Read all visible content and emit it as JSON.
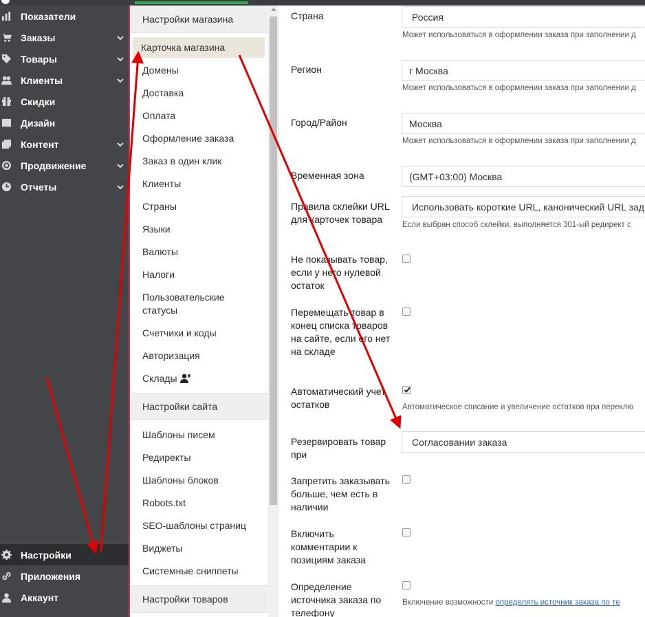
{
  "nav": {
    "items": [
      {
        "label": "Показатели",
        "icon": "bar-chart-icon",
        "chevron": false
      },
      {
        "label": "Заказы",
        "icon": "cart-icon",
        "chevron": true
      },
      {
        "label": "Товары",
        "icon": "tag-icon",
        "chevron": true
      },
      {
        "label": "Клиенты",
        "icon": "users-icon",
        "chevron": true
      },
      {
        "label": "Скидки",
        "icon": "gift-icon",
        "chevron": false
      },
      {
        "label": "Дизайн",
        "icon": "image-icon",
        "chevron": false
      },
      {
        "label": "Контент",
        "icon": "copy-icon",
        "chevron": true
      },
      {
        "label": "Продвижение",
        "icon": "target-icon",
        "chevron": true
      },
      {
        "label": "Отчеты",
        "icon": "clock-icon",
        "chevron": true
      }
    ],
    "bottom": [
      {
        "label": "Настройки",
        "icon": "gear-icon",
        "active": true
      },
      {
        "label": "Приложения",
        "icon": "link-icon",
        "active": false
      },
      {
        "label": "Аккаунт",
        "icon": "user-icon",
        "active": false
      }
    ]
  },
  "submenu": {
    "store_head": "Настройки магазина",
    "store_items": [
      "Карточка магазина",
      "Домены",
      "Доставка",
      "Оплата",
      "Оформление заказа",
      "Заказ в один клик",
      "Клиенты",
      "Страны",
      "Языки",
      "Валюты",
      "Налоги",
      "Пользовательские статусы",
      "Счетчики и коды",
      "Авторизация",
      "Склады"
    ],
    "site_head": "Настройки сайта",
    "site_items": [
      "Шаблоны писем",
      "Редиректы",
      "Шаблоны блоков",
      "Robots.txt",
      "SEO-шаблоны страниц",
      "Виджеты",
      "Системные сниппеты"
    ],
    "goods_head": "Настройки товаров"
  },
  "form": {
    "country_label": "Страна",
    "country_value": "Россия",
    "hint_text": "Может использоваться в оформлении заказа при заполнении д",
    "region_label": "Регион",
    "region_value": "г Москва",
    "city_label": "Город/Район",
    "city_value": "Москва",
    "tz_label": "Временная зона",
    "tz_value": "(GMT+03:00) Москва",
    "url_label": "Правила склейки URL для карточек товара",
    "url_value": "Использовать короткие URL, канонический URL зад",
    "url_hint": "Если выбран способ склейки, выполняется 301-ый редирект с",
    "hide_zero_label": "Не показывать товар, если у него нулевой остаток",
    "move_end_label": "Перемещать товар в конец списка товаров на сайте, если его нет на складе",
    "auto_stock_label": "Автоматический учет остатков",
    "auto_stock_hint": "Автоматическое списание и увеличение остатков при переклю",
    "reserve_label": "Резервировать товар при",
    "reserve_value": "Согласовании заказа",
    "forbid_label": "Запретить заказывать больше, чем есть в наличии",
    "comments_label": "Включить комментарии к позициям заказа",
    "source_label": "Определение источника заказа по телефону",
    "source_hint_prefix": "Включение возможности ",
    "source_hint_link": "определять источник заказа по те"
  }
}
